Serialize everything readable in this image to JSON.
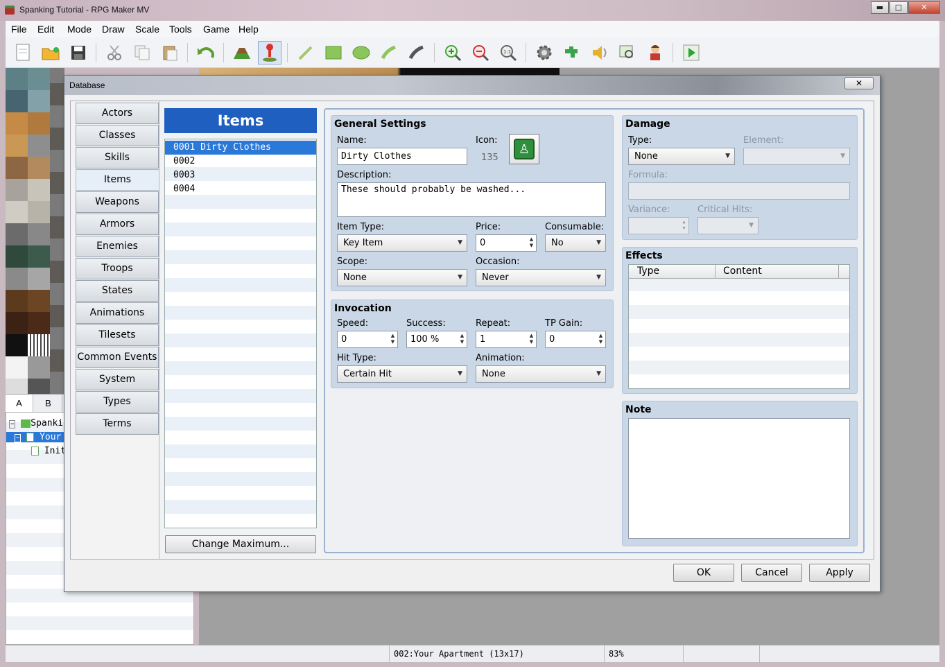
{
  "window": {
    "title": "Spanking Tutorial - RPG Maker MV",
    "minimize": "▬",
    "maximize": "□",
    "close": "✕"
  },
  "menu": [
    "File",
    "Edit",
    "Mode",
    "Draw",
    "Scale",
    "Tools",
    "Game",
    "Help"
  ],
  "toolbar_icons": [
    "new-project-icon",
    "open-project-icon",
    "save-project-icon",
    "cut-icon",
    "copy-icon",
    "paste-icon",
    "undo-icon",
    "map-mode-icon",
    "event-mode-icon",
    "pencil-icon",
    "rectangle-icon",
    "ellipse-icon",
    "fill-icon",
    "shadow-pen-icon",
    "zoom-in-icon",
    "zoom-out-icon",
    "actual-size-icon",
    "database-icon",
    "plugin-manager-icon",
    "sound-test-icon",
    "event-searcher-icon",
    "character-generator-icon",
    "playtest-icon"
  ],
  "tileset_tabs": [
    "A",
    "B"
  ],
  "map_tree": {
    "project": "Spankin",
    "map": "Your A",
    "child": "Init"
  },
  "statusbar": {
    "map_info": "002:Your Apartment (13x17)",
    "zoom": "83%"
  },
  "dialog": {
    "title": "Database",
    "close": "✕",
    "categories": [
      "Actors",
      "Classes",
      "Skills",
      "Items",
      "Weapons",
      "Armors",
      "Enemies",
      "Troops",
      "States",
      "Animations",
      "Tilesets",
      "Common Events",
      "System",
      "Types",
      "Terms"
    ],
    "selected_category": "Items",
    "list_header": "Items",
    "items": [
      "0001 Dirty Clothes",
      "0002",
      "0003",
      "0004"
    ],
    "change_max": "Change Maximum...",
    "general": {
      "title": "General Settings",
      "name_label": "Name:",
      "name": "Dirty Clothes",
      "icon_label": "Icon:",
      "icon_index": "135",
      "description_label": "Description:",
      "description": "These should probably be washed...",
      "item_type_label": "Item Type:",
      "item_type": "Key Item",
      "price_label": "Price:",
      "price": "0",
      "consumable_label": "Consumable:",
      "consumable": "No",
      "scope_label": "Scope:",
      "scope": "None",
      "occasion_label": "Occasion:",
      "occasion": "Never"
    },
    "invocation": {
      "title": "Invocation",
      "speed_label": "Speed:",
      "speed": "0",
      "success_label": "Success:",
      "success": "100 %",
      "repeat_label": "Repeat:",
      "repeat": "1",
      "tp_label": "TP Gain:",
      "tp": "0",
      "hit_type_label": "Hit Type:",
      "hit_type": "Certain Hit",
      "animation_label": "Animation:",
      "animation": "None"
    },
    "damage": {
      "title": "Damage",
      "type_label": "Type:",
      "type": "None",
      "element_label": "Element:",
      "element": "",
      "formula_label": "Formula:",
      "formula": "",
      "variance_label": "Variance:",
      "variance": "",
      "critical_label": "Critical Hits:",
      "critical": ""
    },
    "effects": {
      "title": "Effects",
      "col_type": "Type",
      "col_content": "Content"
    },
    "note": {
      "title": "Note",
      "text": ""
    },
    "buttons": {
      "ok": "OK",
      "cancel": "Cancel",
      "apply": "Apply"
    }
  },
  "colors": {
    "list_header": "#1e5fbf",
    "selection": "#2a78d8",
    "group_bg": "#cad7e6"
  }
}
